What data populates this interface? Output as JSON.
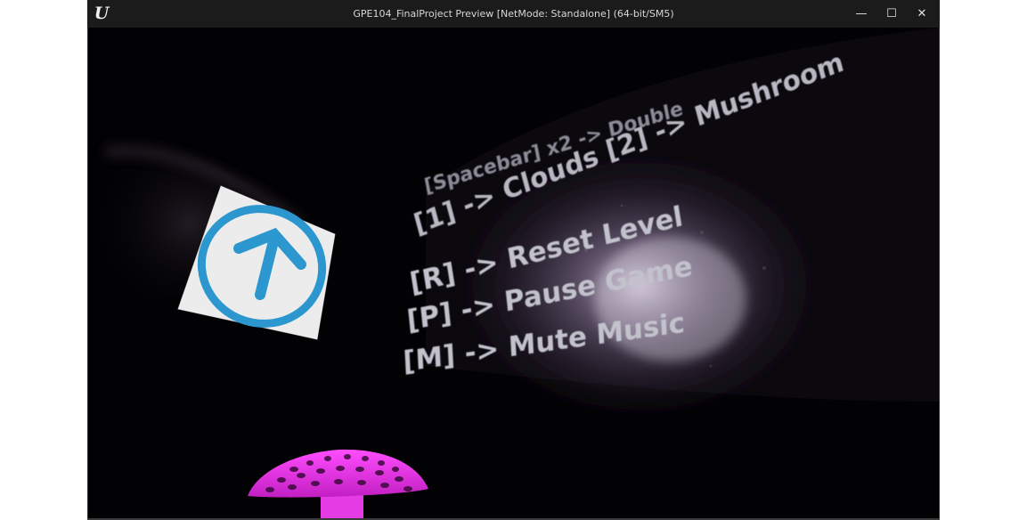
{
  "window": {
    "title": "GPE104_FinalProject Preview [NetMode: Standalone]  (64-bit/SM5)",
    "logo_icon": "unreal-engine-logo-icon",
    "minimize_label": "—",
    "maximize_label": "☐",
    "close_label": "✕"
  },
  "game": {
    "controls": {
      "line_doublejump": "[Spacebar] x2 -> Double",
      "line_swap": "[1] -> Clouds [2] -> Mushroom",
      "line_reset": "[R] -> Reset Level",
      "line_pause": "[P] -> Pause Game",
      "line_mute": "[M] -> Mute Music"
    },
    "colors": {
      "text": "#bdbdc6",
      "glow": "#c9bbd6",
      "sign_background": "#ececec",
      "arrow": "#2c97cf",
      "mushroom": "#e63ce6",
      "mushroom_spots": "#3a0a3a"
    }
  }
}
